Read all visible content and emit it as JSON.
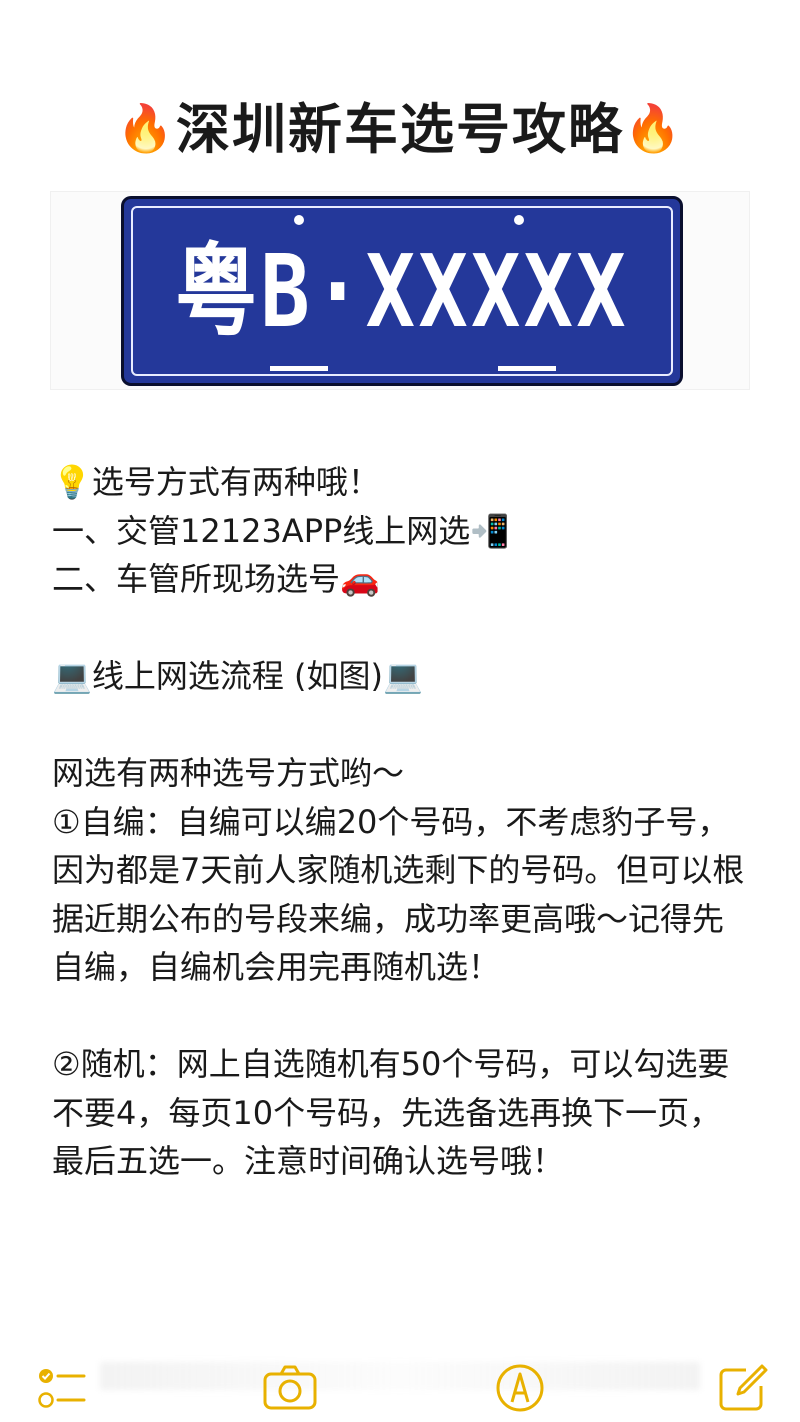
{
  "header": {
    "fire_left": "🔥",
    "title": "深圳新车选号攻略",
    "fire_right": "🔥"
  },
  "plate": {
    "text": "粤B·XXXXX",
    "bg_color": "#24389a"
  },
  "content": {
    "l1": "💡选号方式有两种哦！",
    "l2": "一、交管12123APP线上网选📲",
    "l3": "二、车管所现场选号🚗",
    "l4": "💻线上网选流程 (如图)💻",
    "l5": "网选有两种选号方式哟～",
    "p1": "①自编：自编可以编20个号码，不考虑豹子号，因为都是7天前人家随机选剩下的号码。但可以根据近期公布的号段来编，成功率更高哦～记得先自编，自编机会用完再随机选！",
    "p2": "②随机：网上自选随机有50个号码，可以勾选要不要4，每页10个号码，先选备选再换下一页，最后五选一。注意时间确认选号哦！"
  },
  "toolbar": {
    "accent": "#e8b100",
    "icons": [
      "checklist-icon",
      "camera-icon",
      "markup-pen-icon",
      "compose-icon"
    ]
  }
}
